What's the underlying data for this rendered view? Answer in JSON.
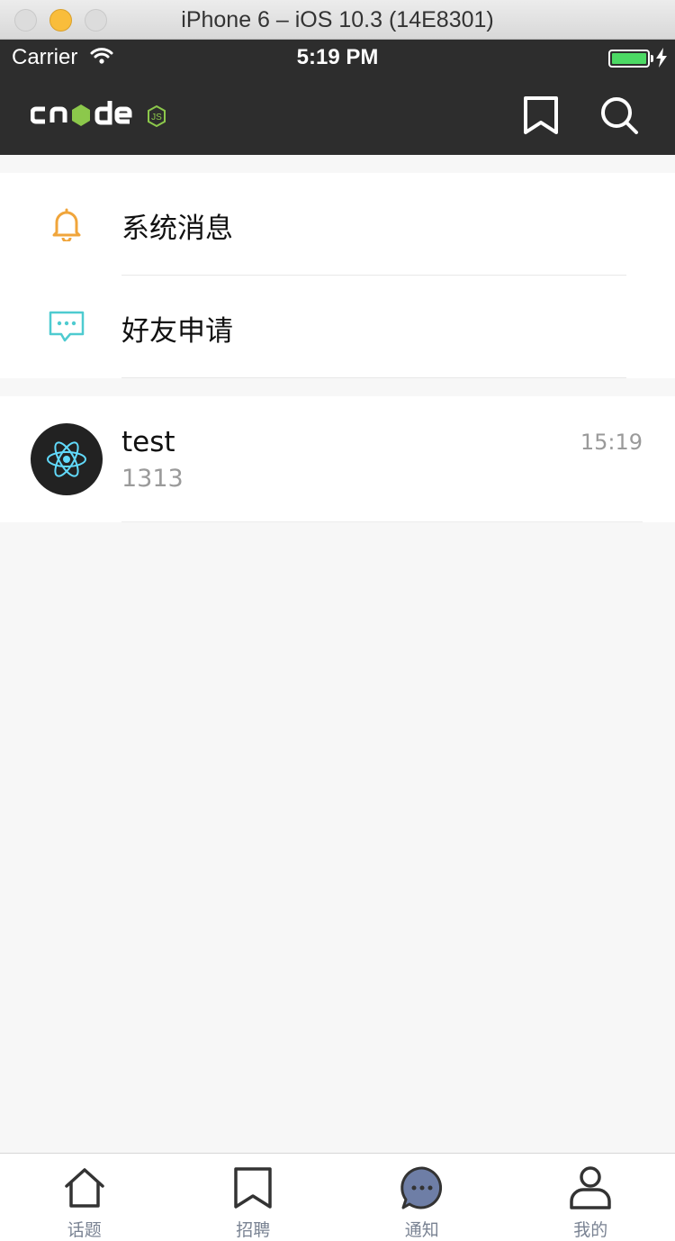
{
  "simulator": {
    "title": "iPhone 6 – iOS 10.3 (14E8301)"
  },
  "status_bar": {
    "carrier": "Carrier",
    "time": "5:19 PM",
    "battery_color": "#4cd964"
  },
  "nav": {
    "logo_icon": "cnodejs-logo",
    "actions": [
      "bookmark-icon",
      "search-icon"
    ]
  },
  "system_items": [
    {
      "label": "系统消息",
      "icon": "bell-icon",
      "color": "#f0a53b"
    },
    {
      "label": "好友申请",
      "icon": "chat-bubble-icon",
      "color": "#4ecbd0"
    }
  ],
  "messages": [
    {
      "name": "test",
      "preview": "1313",
      "time": "15:19",
      "avatar_icon": "react-atom-icon"
    }
  ],
  "tabs": [
    {
      "label": "话题",
      "icon": "home-icon"
    },
    {
      "label": "招聘",
      "icon": "bookmark-icon"
    },
    {
      "label": "通知",
      "icon": "message-dots-icon"
    },
    {
      "label": "我的",
      "icon": "user-icon"
    }
  ]
}
